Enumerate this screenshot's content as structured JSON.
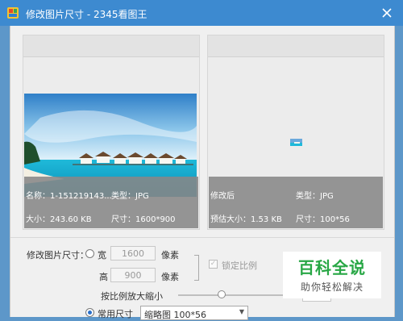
{
  "window": {
    "title": "修改图片尺寸 - 2345看图王",
    "close_icon": "close-icon",
    "app_icon": "app-icon"
  },
  "original": {
    "name_label": "名称：1-151219143...",
    "type_label": "类型：JPG",
    "size_label": "大小：243.60 KB",
    "dimension_label": "尺寸：1600*900"
  },
  "modified": {
    "name_label": "修改后",
    "type_label": "类型：JPG",
    "size_label": "预估大小：1.53 KB",
    "dimension_label": "尺寸：100*56"
  },
  "resize": {
    "section_label": "修改图片尺寸：",
    "width_label": "宽",
    "width_value": "1600",
    "width_unit": "像素",
    "height_label": "高",
    "height_value": "900",
    "height_unit": "像素",
    "lock_label": "锁定比例",
    "scale_label": "按比例放大缩小",
    "preset_label": "常用尺寸",
    "preset_value": "缩略图 100*56"
  },
  "watermark": {
    "title": "百科全说",
    "subtitle": "助你轻松解决"
  }
}
